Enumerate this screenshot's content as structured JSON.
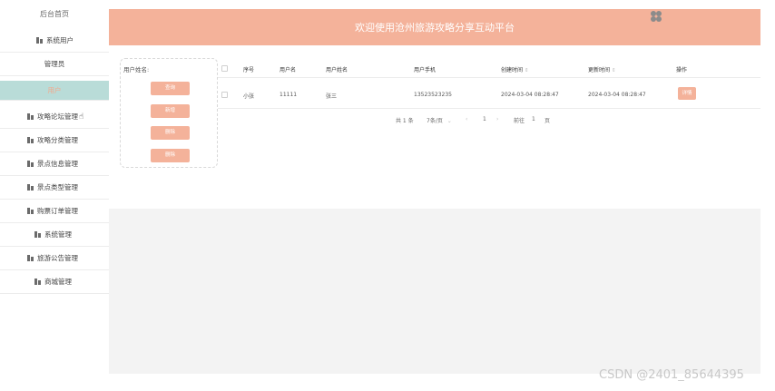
{
  "sidebar": {
    "brand": "后台首页",
    "items": [
      {
        "label": "系统用户"
      },
      {
        "label": "管理员"
      },
      {
        "label": "用户"
      },
      {
        "label": "攻略论坛管理"
      },
      {
        "label": "攻略分类管理"
      },
      {
        "label": "景点信息管理"
      },
      {
        "label": "景点类型管理"
      },
      {
        "label": "购票订单管理"
      },
      {
        "label": "系统管理"
      },
      {
        "label": "旅游公告管理"
      },
      {
        "label": "商城管理"
      }
    ]
  },
  "header": {
    "title": "欢迎使用沧州旅游攻略分享互动平台"
  },
  "filter": {
    "label": "用户姓名:",
    "buttons": {
      "search": "查询",
      "add": "新增",
      "delete": "删除",
      "remove": "删除"
    }
  },
  "table": {
    "columns": [
      "序号",
      "用户名",
      "用户姓名",
      "用户手机",
      "创建时间",
      "更新时间",
      "操作"
    ],
    "rows": [
      {
        "index": "小张",
        "username": "11111",
        "name": "张三",
        "phone": "13523523235",
        "created": "2024-03-04 08:28:47",
        "updated": "2024-03-04 08:28:47",
        "action": "详情"
      }
    ]
  },
  "pager": {
    "total": "共 1 条",
    "page_size": "7条/页",
    "current": "1",
    "goto": "前往",
    "goto_value": "1",
    "page_unit": "页"
  },
  "watermark": "CSDN @2401_85644395",
  "colors": {
    "accent": "#f4b29a",
    "active_bg": "#b9dcd8"
  }
}
